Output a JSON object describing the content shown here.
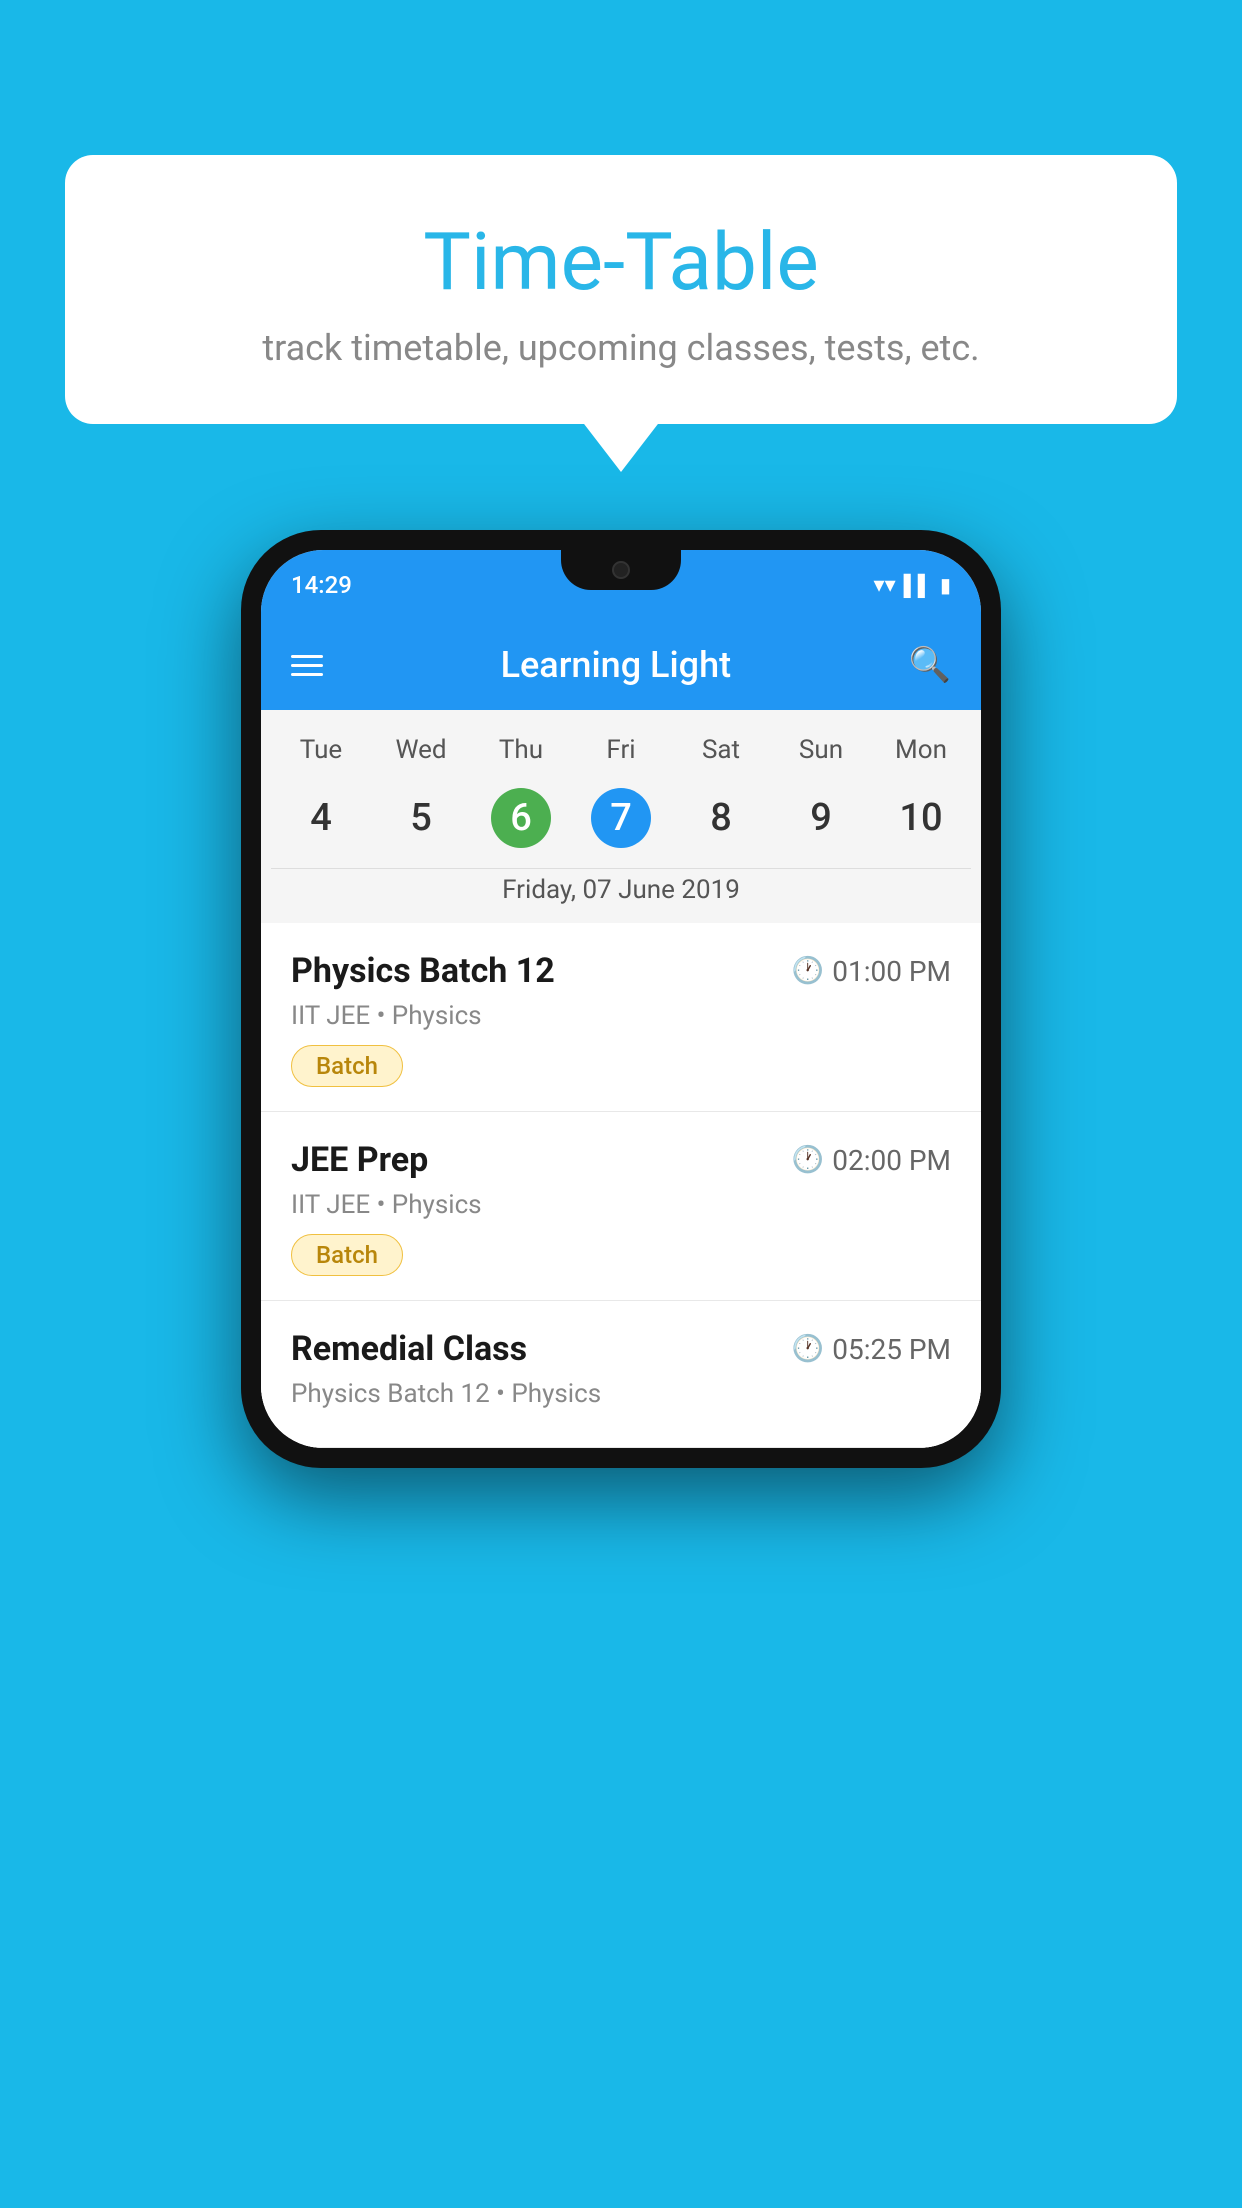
{
  "background_color": "#19b8e8",
  "bubble": {
    "title": "Time-Table",
    "subtitle": "track timetable, upcoming classes, tests, etc."
  },
  "phone": {
    "status_bar": {
      "time": "14:29"
    },
    "app_bar": {
      "title": "Learning Light"
    },
    "calendar": {
      "days": [
        "Tue",
        "Wed",
        "Thu",
        "Fri",
        "Sat",
        "Sun",
        "Mon"
      ],
      "dates": [
        "4",
        "5",
        "6",
        "7",
        "8",
        "9",
        "10"
      ],
      "today_index": 2,
      "selected_index": 3,
      "selected_label": "Friday, 07 June 2019"
    },
    "classes": [
      {
        "name": "Physics Batch 12",
        "time": "01:00 PM",
        "meta": "IIT JEE • Physics",
        "badge": "Batch"
      },
      {
        "name": "JEE Prep",
        "time": "02:00 PM",
        "meta": "IIT JEE • Physics",
        "badge": "Batch"
      },
      {
        "name": "Remedial Class",
        "time": "05:25 PM",
        "meta": "Physics Batch 12 • Physics",
        "badge": null
      }
    ]
  },
  "labels": {
    "batch": "Batch",
    "search": "search"
  }
}
